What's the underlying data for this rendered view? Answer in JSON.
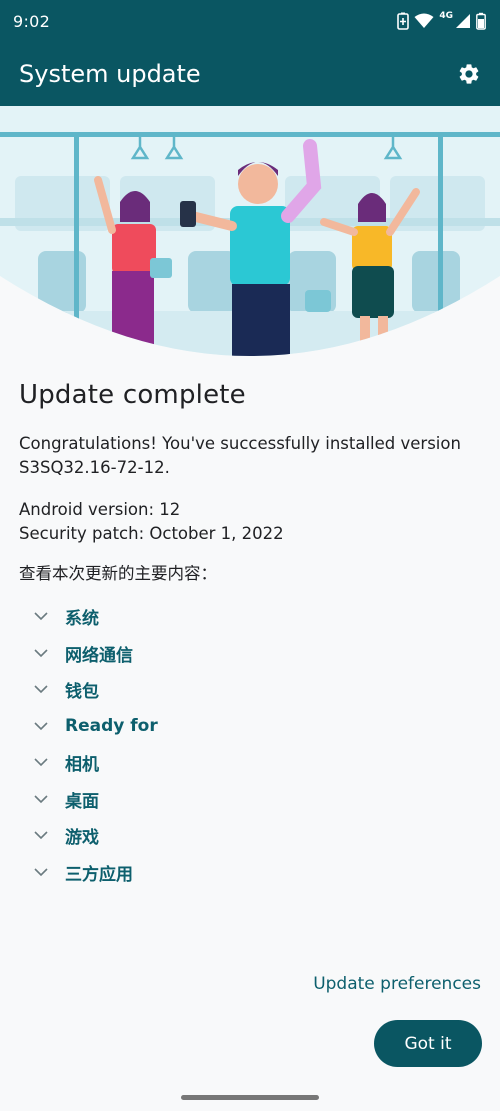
{
  "status_bar": {
    "time": "9:02",
    "network": "4G"
  },
  "app_bar": {
    "title": "System update"
  },
  "update": {
    "title": "Update complete",
    "message": "Congratulations! You've successfully installed version S3SQ32.16-72-12.",
    "android_version": "Android version: 12",
    "security_patch": "Security patch: October 1, 2022",
    "changes_heading": "查看本次更新的主要内容："
  },
  "changes": [
    {
      "label": "系统"
    },
    {
      "label": "网络通信"
    },
    {
      "label": "钱包"
    },
    {
      "label": "Ready for"
    },
    {
      "label": "相机"
    },
    {
      "label": "桌面"
    },
    {
      "label": "游戏"
    },
    {
      "label": "三方应用"
    }
  ],
  "actions": {
    "update_preferences": "Update preferences",
    "got_it": "Got it"
  },
  "colors": {
    "primary": "#0a5662",
    "accent_text": "#0d5f6d",
    "background": "#f8f9fa"
  },
  "icons": [
    "battery-saver-icon",
    "wifi-icon",
    "signal-icon",
    "battery-icon",
    "gear-icon",
    "chevron-down-icon"
  ]
}
